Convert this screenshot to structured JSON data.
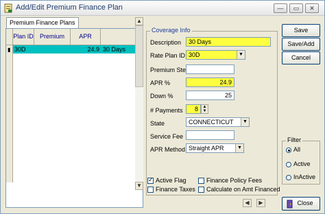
{
  "window": {
    "title": "Add/Edit Premium Finance Plan",
    "controls": {
      "minimize": "—",
      "restore": "▭",
      "close": "✕"
    }
  },
  "tab": {
    "label": "Premium Finance Plans"
  },
  "grid": {
    "columns": [
      "Plan ID",
      "Premium",
      "APR",
      ""
    ],
    "rows": [
      {
        "plan_id": "30D",
        "premium": "",
        "apr": "24.9",
        "description": "30 Days"
      }
    ]
  },
  "coverage": {
    "legend": "Coverage Info",
    "description": {
      "label": "Description",
      "value": "30 Days"
    },
    "rate_plan_id": {
      "label": "Rate Plan ID",
      "value": "30D"
    },
    "premium_step": {
      "label": "Premium Step",
      "value": ""
    },
    "apr_pct": {
      "label": "APR %",
      "value": "24.9"
    },
    "down_pct": {
      "label": "Down %",
      "value": "25"
    },
    "num_payments": {
      "label": "# Payments",
      "value": "8"
    },
    "state": {
      "label": "State",
      "value": "CONNECTICUT"
    },
    "service_fee": {
      "label": "Service Fee",
      "value": ""
    },
    "apr_method": {
      "label": "APR Method",
      "value": "Straight APR"
    }
  },
  "checkboxes": {
    "active_flag": {
      "label": "Active Flag",
      "checked": true
    },
    "finance_policy_fees": {
      "label": "Finance Policy Fees",
      "checked": false
    },
    "finance_taxes": {
      "label": "Finance Taxes",
      "checked": false
    },
    "calculate_on_amt_financed": {
      "label": "Calculate on Amt Financed",
      "checked": false
    }
  },
  "buttons": {
    "save": "Save",
    "save_add": "Save/Add",
    "cancel": "Cancel",
    "close": "Close"
  },
  "filter": {
    "legend": "Filter",
    "options": [
      "All",
      "Active",
      "InActive"
    ],
    "selected": "All"
  },
  "colors": {
    "accent_selected_row": "#00c0c0",
    "required_field": "#ffff40",
    "label_blue": "#1f3b9b"
  }
}
